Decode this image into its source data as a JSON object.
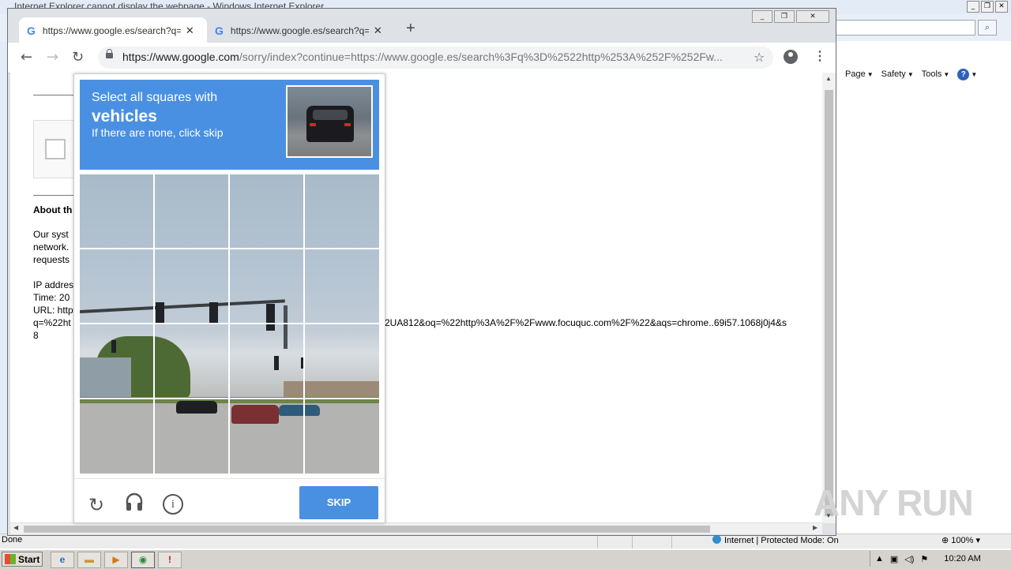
{
  "ie": {
    "title": "Internet Explorer cannot display the webpage - Windows Internet Explorer",
    "commands": [
      {
        "label": "Page"
      },
      {
        "label": "Safety"
      },
      {
        "label": "Tools"
      }
    ],
    "status_text": "Done",
    "zone": "Internet | Protected Mode: On",
    "zoom": "100%"
  },
  "taskbar": {
    "start_label": "Start",
    "clock": "10:20 AM"
  },
  "chrome": {
    "tabs": [
      {
        "title": "https://www.google.es/search?q=%"
      },
      {
        "title": "https://www.google.es/search?q=%"
      }
    ],
    "url_host": "https://www.google.com",
    "url_rest": "/sorry/index?continue=https://www.google.es/search%3Fq%3D%2522http%253A%252F%252Fw..."
  },
  "page": {
    "about_heading": "About th",
    "lines": [
      "Our syst",
      "network.",
      "requests",
      "",
      "IP addres",
      "Time: 20",
      "URL: http",
      "q=%22ht",
      "8"
    ],
    "url_tail": "2UA812&oq=%22http%3A%2F%2Fwww.focuquc.com%2F%22&aqs=chrome..69i57.1068j0j4&s"
  },
  "captcha": {
    "line1": "Select all squares with",
    "line2": "vehicles",
    "line3": "If there are none, click skip",
    "skip_label": "SKIP",
    "grid_size": 4
  },
  "watermark": "ANY RUN"
}
